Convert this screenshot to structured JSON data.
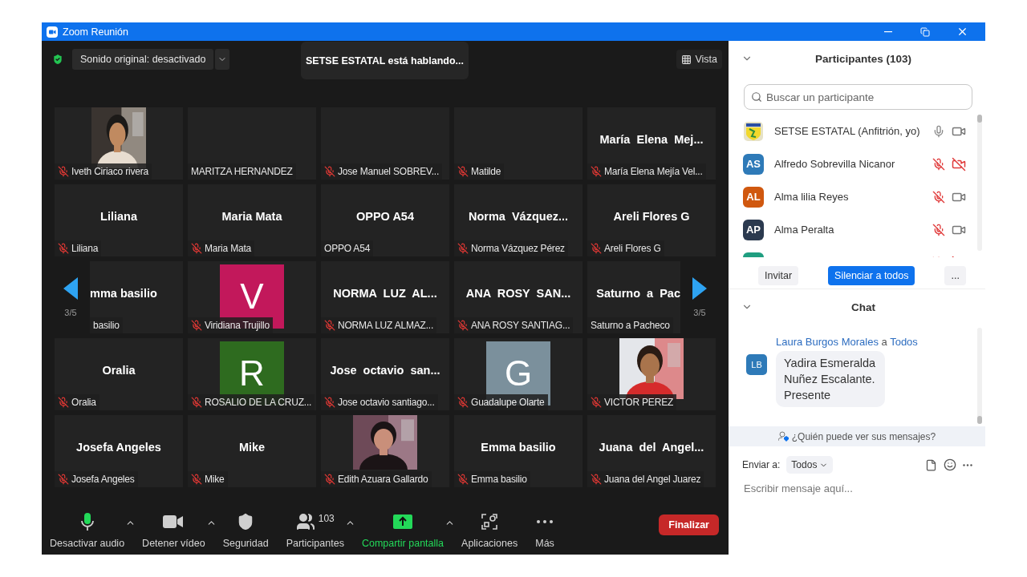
{
  "window": {
    "title": "Zoom Reunión"
  },
  "meeting_bar": {
    "audio_dropdown": "Sonido original: desactivado",
    "speaking_banner": "SETSE ESTATAL está hablando...",
    "view_button": "Vista"
  },
  "grid": {
    "rows": [
      {
        "tiles": [
          {
            "kind": "picture",
            "label": "Iveth Ciriaco rivera",
            "muted": true
          },
          {
            "kind": "blank",
            "label": "MARITZA HERNANDEZ",
            "muted": false
          },
          {
            "kind": "blank",
            "label": "Jose Manuel SOBREV...",
            "muted": true
          },
          {
            "kind": "blank",
            "label": "Matilde",
            "muted": true
          },
          {
            "kind": "name",
            "title": "María  Elena  Mej...",
            "label": "María Elena Mejía Vel...",
            "muted": true
          }
        ]
      },
      {
        "tiles": [
          {
            "kind": "name",
            "title": "Liliana",
            "label": "Liliana",
            "muted": true
          },
          {
            "kind": "name",
            "title": "Maria Mata",
            "label": "Maria Mata",
            "muted": true
          },
          {
            "kind": "name",
            "title": "OPPO A54",
            "label": "OPPO A54",
            "muted": false
          },
          {
            "kind": "name",
            "title": "Norma  Vázquez...",
            "label": "Norma Vázquez Pérez",
            "muted": true
          },
          {
            "kind": "name",
            "title": "Areli Flores G",
            "label": "Areli Flores G",
            "muted": true
          }
        ]
      },
      {
        "pager": {
          "left": "3/5",
          "right": "3/5"
        },
        "tiles": [
          {
            "kind": "name",
            "title": "mma basilio",
            "label": "basilio",
            "muted": false
          },
          {
            "kind": "avatar",
            "letter": "V",
            "color": "#c2185b",
            "label": "Viridiana Trujillo",
            "muted": true
          },
          {
            "kind": "name",
            "title": "NORMA  LUZ  AL...",
            "label": "NORMA LUZ ALMAZ...",
            "muted": true
          },
          {
            "kind": "name",
            "title": "ANA  ROSY  SAN...",
            "label": "ANA ROSY SANTIAG...",
            "muted": true
          },
          {
            "kind": "name",
            "title": "Saturno  a  Pac",
            "label": "Saturno a Pacheco",
            "muted": false
          }
        ]
      },
      {
        "tiles": [
          {
            "kind": "name",
            "title": "Oralia",
            "label": "Oralia",
            "muted": true
          },
          {
            "kind": "avatar",
            "letter": "R",
            "color": "#2e6b1f",
            "label": "ROSALIO DE LA CRUZ...",
            "muted": true
          },
          {
            "kind": "name",
            "title": "Jose  octavio  san...",
            "label": "Jose octavio santiago...",
            "muted": true
          },
          {
            "kind": "avatar",
            "letter": "G",
            "color": "#7b909c",
            "label": "Guadalupe Olarte",
            "muted": true
          },
          {
            "kind": "picture",
            "label": "VICTOR PEREZ",
            "muted": true
          }
        ]
      },
      {
        "tiles": [
          {
            "kind": "name",
            "title": "Josefa Angeles",
            "label": "Josefa Angeles",
            "muted": true
          },
          {
            "kind": "name",
            "title": "Mike",
            "label": "Mike",
            "muted": true
          },
          {
            "kind": "picture",
            "label": "Edith Azuara Gallardo",
            "muted": true
          },
          {
            "kind": "name",
            "title": "Emma basilio",
            "label": "Emma basilio",
            "muted": true
          },
          {
            "kind": "name",
            "title": "Juana  del  Angel...",
            "label": "Juana del Angel Juarez",
            "muted": true
          }
        ]
      }
    ]
  },
  "toolbar": {
    "items": [
      {
        "kind": "audio",
        "label": "Desactivar audio",
        "caret": true
      },
      {
        "kind": "video",
        "label": "Detener vídeo",
        "caret": true
      },
      {
        "kind": "security",
        "label": "Seguridad",
        "caret": false
      },
      {
        "kind": "participants",
        "label": "Participantes",
        "count": "103",
        "caret": true
      },
      {
        "kind": "share",
        "label": "Compartir pantalla",
        "caret": true
      },
      {
        "kind": "apps",
        "label": "Aplicaciones",
        "caret": false
      },
      {
        "kind": "more",
        "label": "Más",
        "caret": false
      }
    ],
    "end_button": "Finalizar"
  },
  "participants": {
    "title": "Participantes (103)",
    "search": {
      "placeholder": "Buscar un participante"
    },
    "people": [
      {
        "kind": "emblem",
        "name": "SETSE ESTATAL (Anfitrión, yo)",
        "mic_muted": false,
        "video_off": false
      },
      {
        "kind": "initials",
        "initials": "AS",
        "color": "#2e7ab8",
        "name": "Alfredo Sobrevilla Nicanor",
        "mic_muted": true,
        "video_off": true
      },
      {
        "kind": "initials",
        "initials": "AL",
        "color": "#d0580f",
        "name": "Alma lilia Reyes",
        "mic_muted": true,
        "video_off": false
      },
      {
        "kind": "initials",
        "initials": "AP",
        "color": "#2b3a4f",
        "name": "Alma Peralta",
        "mic_muted": true,
        "video_off": false
      },
      {
        "kind": "initials",
        "color": "#1f9e80",
        "mic_muted": true,
        "video_off": true
      }
    ],
    "buttons": [
      {
        "kind": "plain",
        "label": "Invitar"
      },
      {
        "kind": "primary",
        "label": "Silenciar a todos"
      },
      {
        "kind": "plain",
        "label": "..."
      }
    ]
  },
  "chat": {
    "title": "Chat",
    "messages": [
      {
        "sender": "Laura Burgos Morales",
        "connector": "a",
        "recipient": "Todos",
        "initials": "LB",
        "text": "Yadira Esmeralda Nuñez Escalante. Presente"
      }
    ],
    "privacy_note": "¿Quién puede ver sus mensajes?",
    "send_to_label": "Enviar a:",
    "send_to": "Todos",
    "input": {
      "placeholder": "Escribir mensaje aquí..."
    }
  }
}
